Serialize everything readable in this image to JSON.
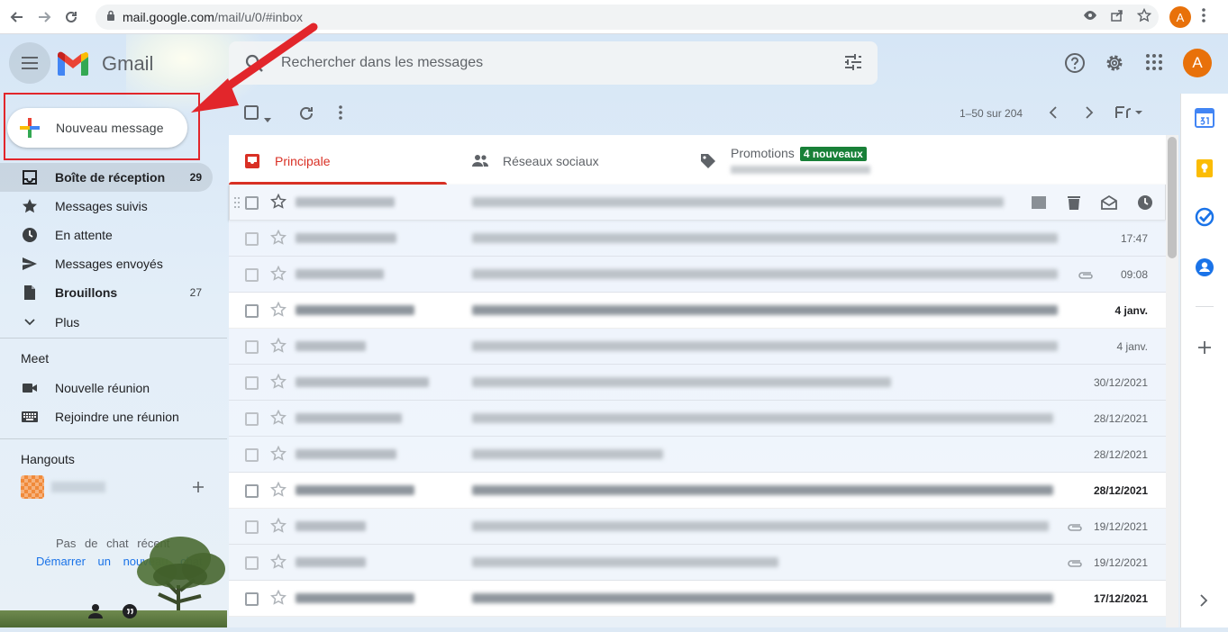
{
  "browser": {
    "url_host": "mail.google.com",
    "url_path": "/mail/u/0/#inbox",
    "avatar_letter": "A"
  },
  "app": {
    "name": "Gmail",
    "search_placeholder": "Rechercher dans les messages",
    "avatar_letter": "A"
  },
  "compose": {
    "label": "Nouveau message"
  },
  "nav": {
    "items": [
      {
        "label": "Boîte de réception",
        "count": "29",
        "icon": "inbox-icon"
      },
      {
        "label": "Messages suivis",
        "count": "",
        "icon": "star-icon"
      },
      {
        "label": "En attente",
        "count": "",
        "icon": "clock-icon"
      },
      {
        "label": "Messages envoyés",
        "count": "",
        "icon": "send-icon"
      },
      {
        "label": "Brouillons",
        "count": "27",
        "icon": "draft-icon"
      },
      {
        "label": "Plus",
        "count": "",
        "icon": "chevron-down-icon"
      }
    ]
  },
  "meet": {
    "title": "Meet",
    "new_meeting": "Nouvelle réunion",
    "join_meeting": "Rejoindre une réunion"
  },
  "hangouts": {
    "title": "Hangouts",
    "no_chats": "Pas de chat récent",
    "start_new": "Démarrer un nouveau chat"
  },
  "toolbar": {
    "pager": "1–50 sur 204"
  },
  "tabs": [
    {
      "label": "Principale",
      "icon": "inbox-tab-icon"
    },
    {
      "label": "Réseaux sociaux",
      "icon": "people-icon"
    },
    {
      "label": "Promotions",
      "icon": "tag-icon",
      "badge": "4 nouveaux"
    }
  ],
  "emails": [
    {
      "date": "",
      "unread": false
    },
    {
      "date": "17:47",
      "unread": false
    },
    {
      "date": "09:08",
      "unread": false
    },
    {
      "date": "4 janv.",
      "unread": true
    },
    {
      "date": "4 janv.",
      "unread": false
    },
    {
      "date": "30/12/2021",
      "unread": false
    },
    {
      "date": "28/12/2021",
      "unread": false
    },
    {
      "date": "28/12/2021",
      "unread": false
    },
    {
      "date": "28/12/2021",
      "unread": true
    },
    {
      "date": "19/12/2021",
      "unread": false
    },
    {
      "date": "19/12/2021",
      "unread": false
    },
    {
      "date": "17/12/2021",
      "unread": true
    }
  ],
  "colors": {
    "accent_red": "#d93025",
    "badge_green": "#188038",
    "avatar_orange": "#e8710a",
    "link_blue": "#1a73e8"
  }
}
